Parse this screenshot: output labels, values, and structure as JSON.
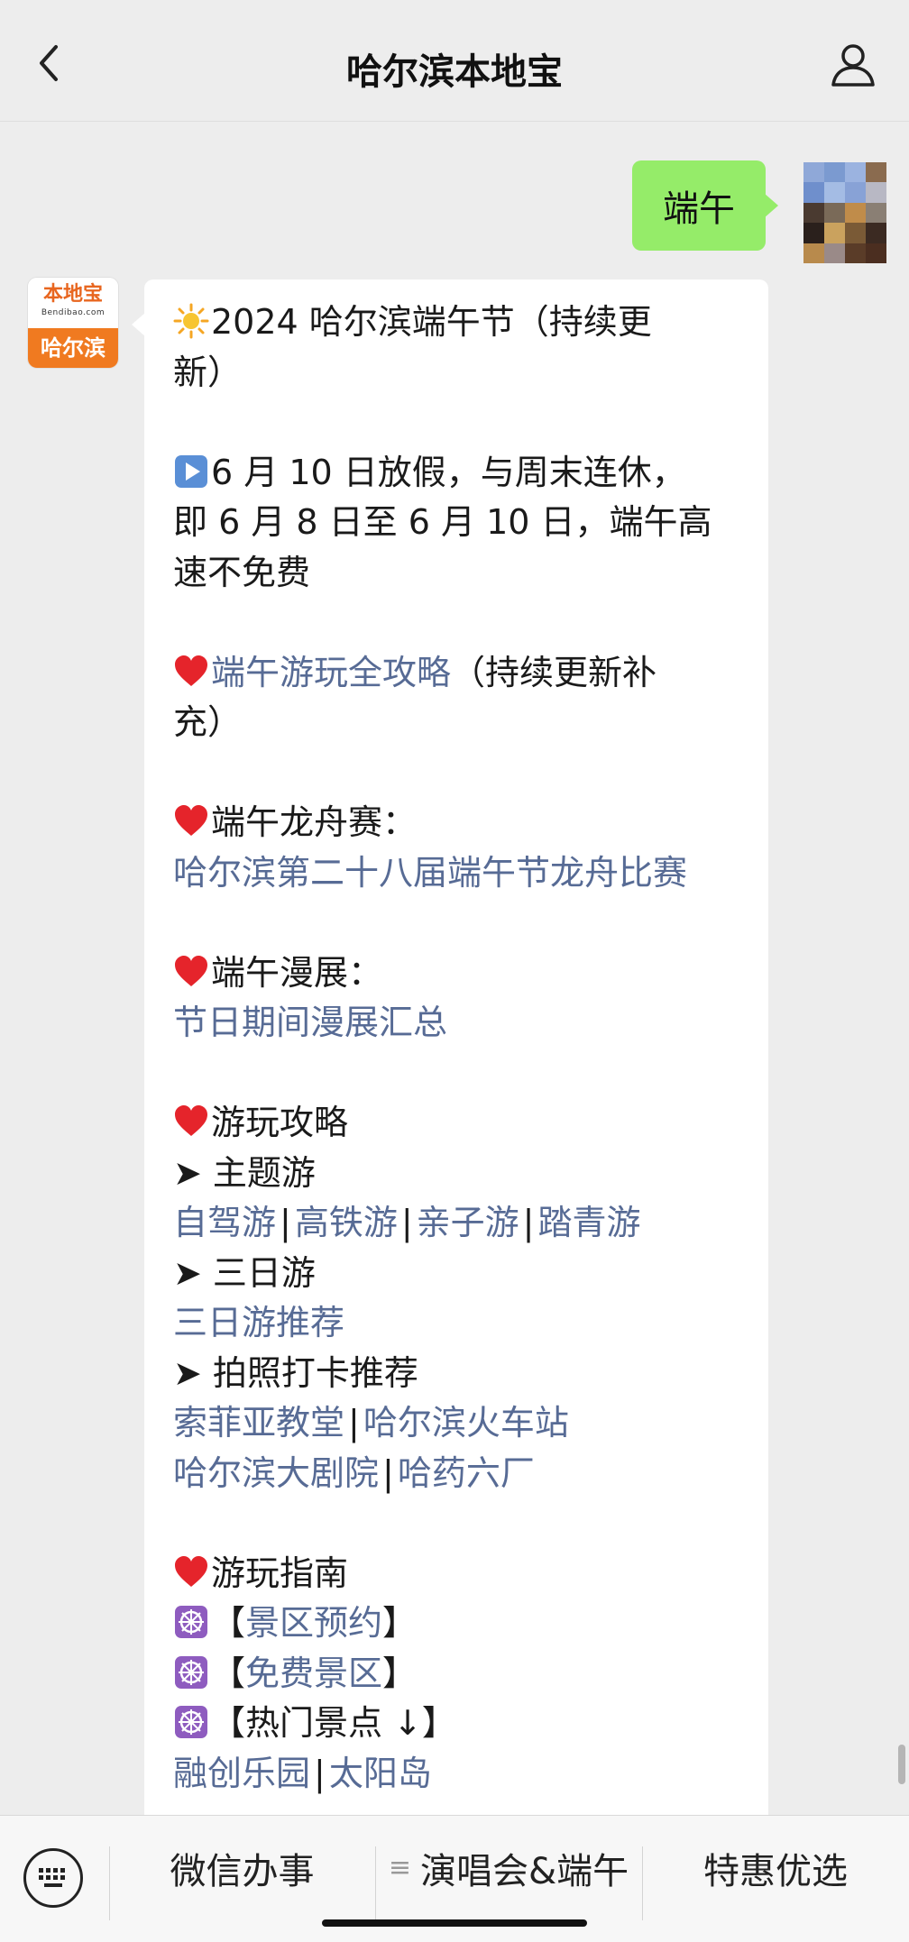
{
  "header": {
    "back_icon": "chevron-left-icon",
    "title": "哈尔滨本地宝",
    "profile_icon": "person-icon"
  },
  "user_message": {
    "text": "端午"
  },
  "bot_avatar": {
    "brand": "本地宝",
    "domain": "Bendibao.com",
    "city": "哈尔滨"
  },
  "bot_message": {
    "heading": "2024 哈尔滨端午节（持续更",
    "heading_cont": "新）",
    "holiday_1": "6 月 10 日放假，与周末连休，",
    "holiday_2": "即 6 月 8 日至 6 月 10 日，端午高",
    "holiday_3": "速不免费",
    "guide_link": "端午游玩全攻略",
    "guide_suffix": "（持续更新补",
    "guide_suffix_2": "充）",
    "dragon_title": "端午龙舟赛：",
    "dragon_link": "哈尔滨第二十八届端午节龙舟比赛",
    "comic_title": "端午漫展：",
    "comic_link": "节日期间漫展汇总",
    "tips_title": "游玩攻略",
    "theme_title": "➤ 主题游",
    "theme_links": [
      "自驾游",
      "高铁游",
      "亲子游",
      "踏青游"
    ],
    "threeday_title": "➤ 三日游",
    "threeday_link": "三日游推荐",
    "photo_title": "➤ 拍照打卡推荐",
    "photo_links_1": [
      "索菲亚教堂",
      "哈尔滨火车站"
    ],
    "photo_links_2": [
      "哈尔滨大剧院",
      "哈药六厂"
    ],
    "guide2_title": "游玩指南",
    "bracket_open": "【",
    "bracket_close": "】",
    "reservation_link": "景区预约",
    "free_link": "免费景区",
    "hot_text": "【热门景点 ↓】",
    "hot_links": [
      "融创乐园",
      "太阳岛"
    ],
    "separator": "|"
  },
  "bottom_menu": {
    "keyboard_icon": "keyboard-icon",
    "item1": "微信办事",
    "item2_icon": "≡",
    "item2": "演唱会&端午",
    "item3": "特惠优选"
  },
  "colors": {
    "link": "#576b95",
    "user_bubble": "#95ec69",
    "background": "#ededed",
    "brand_orange": "#f07a20"
  }
}
